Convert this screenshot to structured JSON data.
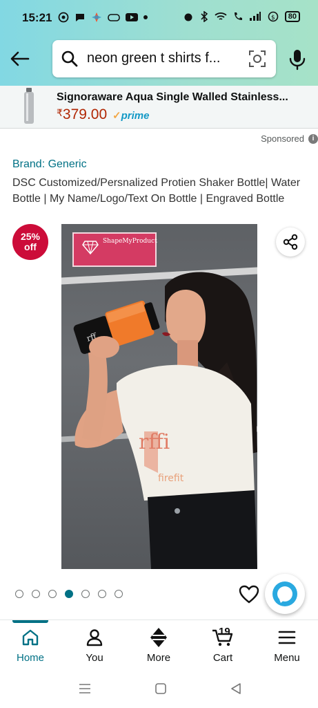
{
  "status_bar": {
    "time": "15:21",
    "battery": "80"
  },
  "search": {
    "query": "neon green t shirts f..."
  },
  "sponsored_product": {
    "title": "Signoraware Aqua Single Walled Stainless...",
    "currency": "₹",
    "price": "379.00",
    "prime_label": "prime"
  },
  "sponsored_label": "Sponsored",
  "product": {
    "brand": "Brand: Generic",
    "title": "DSC Customized/Persnalized Protien Shaker Bottle| Water Bottle | My Name/Logo/Text On Bottle | Engraved Bottle",
    "discount_line1": "25%",
    "discount_line2": "off",
    "image_badge": "ShapeMyProduct",
    "image_count": 7,
    "active_image_index": 3
  },
  "bottom_nav": [
    {
      "label": "Home",
      "icon": "home-icon",
      "active": true
    },
    {
      "label": "You",
      "icon": "person-icon",
      "active": false
    },
    {
      "label": "More",
      "icon": "diamond-icon",
      "active": false
    },
    {
      "label": "Cart",
      "icon": "cart-icon",
      "active": false,
      "badge": "19"
    },
    {
      "label": "Menu",
      "icon": "hamburger-icon",
      "active": false
    }
  ],
  "colors": {
    "link": "#007185",
    "price": "#b12704",
    "discount": "#cc0c39",
    "prime": "#1399c6"
  }
}
